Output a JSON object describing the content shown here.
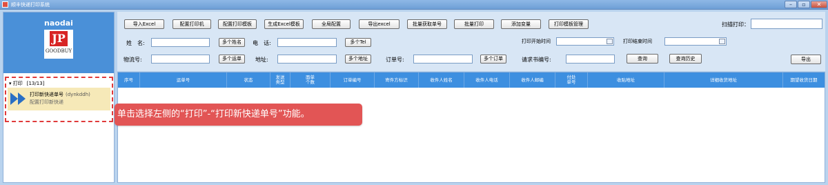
{
  "window": {
    "title": "顺丰快递打印系统"
  },
  "user": {
    "name": "naodai",
    "logo_text": "JP",
    "logo_brand": "GOODBUY"
  },
  "nav": {
    "group_label": "打印",
    "group_count": "[13/13]",
    "item_title": "打印新快递单号",
    "item_code": "(dynkddh)",
    "item_sub": "配置打印新快递"
  },
  "toolbar": {
    "import_excel": "导入Excel",
    "config_printer": "配置打印机",
    "config_template": "配置打印模板",
    "gen_excel_template": "生成Excel模板",
    "global_config": "全局配置",
    "export_excel": "导出excel",
    "batch_get_number": "批量获取单号",
    "batch_print": "批量打印",
    "add_variable": "添加变量",
    "print_template_mgmt": "打印模板管理",
    "scan_print_label": "扫描打印："
  },
  "filters": {
    "name_label": "姓　名:",
    "multi_name": "多个姓名",
    "phone_label": "电　话:",
    "multi_tel": "多个Tel",
    "print_start_label": "打印开始时间",
    "print_end_label": "打印结束时间",
    "logistics_label": "物流号:",
    "multi_waybill": "多个运单",
    "address_label": "地址:",
    "multi_address": "多个地址",
    "order_label": "订单号:",
    "multi_order": "多个订单",
    "request_label": "请求书编号:",
    "query": "查询",
    "query_history": "查询历史",
    "export": "导出"
  },
  "grid": {
    "columns": [
      "序号",
      "运单号",
      "状态",
      "发送\n类型",
      "面单\n个数",
      "订单编号",
      "寄件方标识",
      "收件人姓名",
      "收件人电话",
      "收件人邮编",
      "付处\n单号",
      "收贴地址",
      "详细收货地址",
      "期望收货日期"
    ]
  },
  "callout": {
    "text": "单击选择左侧的“打印”-“打印新快递单号”功能。"
  }
}
